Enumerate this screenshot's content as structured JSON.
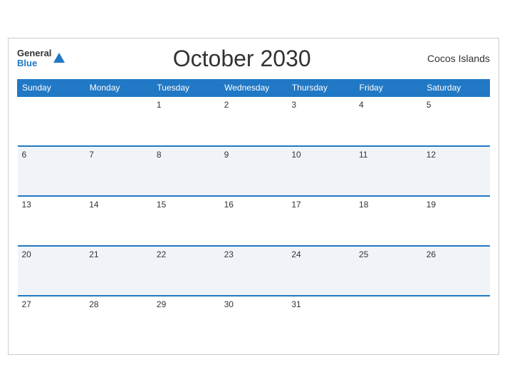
{
  "header": {
    "logo_general": "General",
    "logo_blue": "Blue",
    "title": "October 2030",
    "region": "Cocos Islands"
  },
  "weekdays": [
    "Sunday",
    "Monday",
    "Tuesday",
    "Wednesday",
    "Thursday",
    "Friday",
    "Saturday"
  ],
  "weeks": [
    [
      null,
      null,
      1,
      2,
      3,
      4,
      5
    ],
    [
      6,
      7,
      8,
      9,
      10,
      11,
      12
    ],
    [
      13,
      14,
      15,
      16,
      17,
      18,
      19
    ],
    [
      20,
      21,
      22,
      23,
      24,
      25,
      26
    ],
    [
      27,
      28,
      29,
      30,
      31,
      null,
      null
    ]
  ]
}
